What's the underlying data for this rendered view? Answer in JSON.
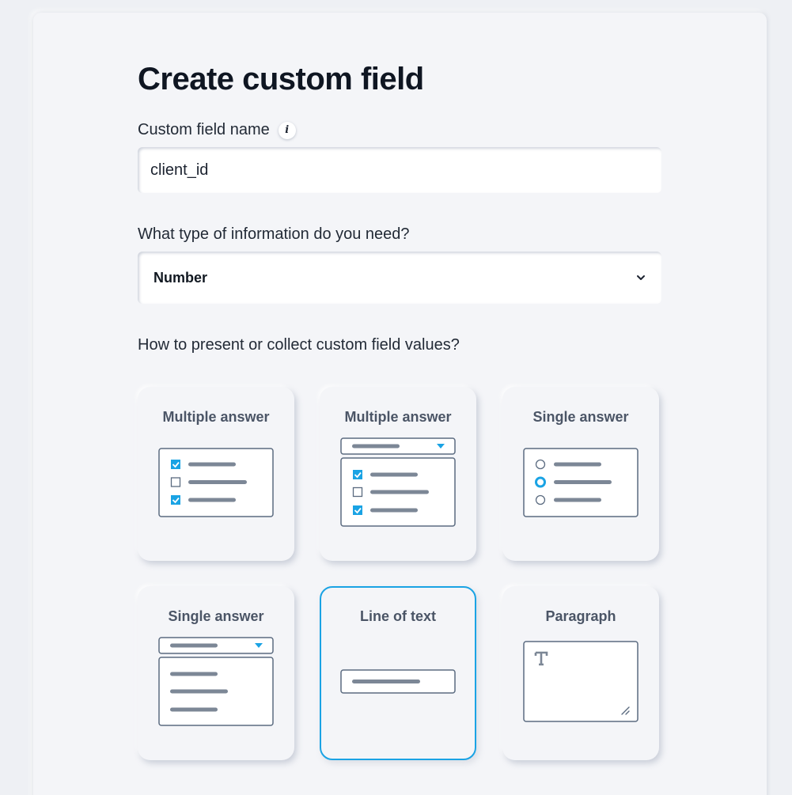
{
  "page": {
    "title": "Create custom field"
  },
  "name_field": {
    "label": "Custom field name",
    "value": "client_id",
    "info_icon": "info-icon"
  },
  "type_field": {
    "label": "What type of information do you need?",
    "selected": "Number"
  },
  "presentation": {
    "label": "How to present or collect custom field values?",
    "options": [
      {
        "title": "Multiple answer",
        "icon": "checkbox-list-icon",
        "selected": false
      },
      {
        "title": "Multiple answer",
        "icon": "multi-select-dropdown-icon",
        "selected": false
      },
      {
        "title": "Single answer",
        "icon": "radio-list-icon",
        "selected": false
      },
      {
        "title": "Single answer",
        "icon": "single-select-dropdown-icon",
        "selected": false
      },
      {
        "title": "Line of text",
        "icon": "text-line-icon",
        "selected": true
      },
      {
        "title": "Paragraph",
        "icon": "paragraph-icon",
        "selected": false
      }
    ]
  },
  "colors": {
    "accent": "#1aa3e4",
    "illustration_stroke": "#5b6b80",
    "illustration_bar": "#7c8796"
  }
}
